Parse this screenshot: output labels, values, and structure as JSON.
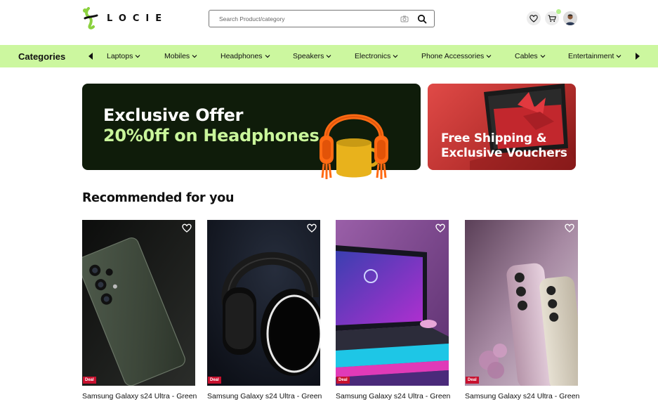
{
  "brand": {
    "name": "LOCIE",
    "accent": "#ccf79f",
    "dark": "#0f1c0a"
  },
  "search": {
    "placeholder": "Search Product/category"
  },
  "header_icons": [
    "heart-icon",
    "cart-icon",
    "user-avatar"
  ],
  "categories": {
    "title": "Categories",
    "items": [
      {
        "label": "Laptops"
      },
      {
        "label": "Mobiles"
      },
      {
        "label": "Headphones"
      },
      {
        "label": "Speakers"
      },
      {
        "label": "Electronics"
      },
      {
        "label": "Phone Accessories"
      },
      {
        "label": "Cables"
      },
      {
        "label": "Entertainment"
      }
    ]
  },
  "banners": {
    "main": {
      "line1": "Exclusive Offer",
      "line2": "20%0ff on Headphones"
    },
    "side": {
      "line1": "Free Shipping &",
      "line2": "Exclusive Vouchers"
    }
  },
  "recommended": {
    "title": "Recommended for you",
    "products": [
      {
        "name": "Samsung Galaxy s24 Ultra - Green",
        "badge": "Deal",
        "image": "phone-green"
      },
      {
        "name": "Samsung Galaxy s24 Ultra - Green",
        "badge": "Deal",
        "image": "headphones-black"
      },
      {
        "name": "Samsung Galaxy s24 Ultra - Green",
        "badge": "Deal",
        "image": "laptop-purple"
      },
      {
        "name": "Samsung Galaxy s24 Ultra - Green",
        "badge": "Deal",
        "image": "phones-lavender"
      }
    ]
  }
}
